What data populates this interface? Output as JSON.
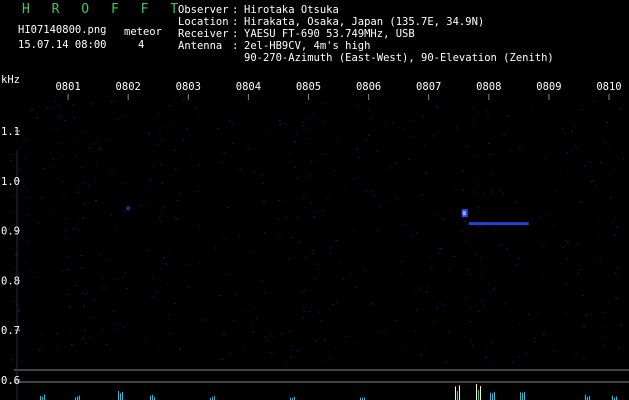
{
  "header": {
    "brand": "H R O F F T",
    "filename": "HI07140800.png",
    "meteor_label": "meteor",
    "datetime": "15.07.14 08:00",
    "meteor_count": "4",
    "observer_key": "Observer",
    "observer": "Hirotaka Otsuka",
    "location_key": "Location",
    "location": "Hirakata, Osaka, Japan (135.7E, 34.9N)",
    "receiver_key": "Receiver",
    "receiver": "YAESU FT-690 53.749MHz, USB",
    "antenna_key": "Antenna",
    "antenna": "2el-HB9CV, 4m's high",
    "antenna_line2": "90-270-Azimuth (East-West), 90-Elevation (Zenith)",
    "colon": ":"
  },
  "colors": {
    "background": "#000000",
    "brand": "#3fc85a",
    "echo": "#3355ff",
    "echo_core": "#9aa8ff",
    "noise": "#1c2a6a",
    "baseline": "#888888",
    "spikes": "#00ccff",
    "spikes_hot": "#ffff66"
  },
  "chart_data": {
    "type": "heatmap",
    "ylabel": "kHz",
    "xticks": [
      "0801",
      "0802",
      "0803",
      "0804",
      "0805",
      "0806",
      "0807",
      "0808",
      "0809",
      "0810"
    ],
    "yticks": [
      1.1,
      1.0,
      0.9,
      0.8,
      0.7,
      0.6
    ],
    "xlim": [
      "0800",
      "0810"
    ],
    "ylim": [
      0.56,
      1.16
    ],
    "echoes": [
      {
        "time": "0807.6",
        "freq": 0.935,
        "intensity": 0.9
      },
      {
        "time": "0807.7",
        "freq": 0.915,
        "intensity": 0.8
      },
      {
        "time": "0802.0",
        "freq": 0.945,
        "intensity": 0.5
      }
    ]
  }
}
